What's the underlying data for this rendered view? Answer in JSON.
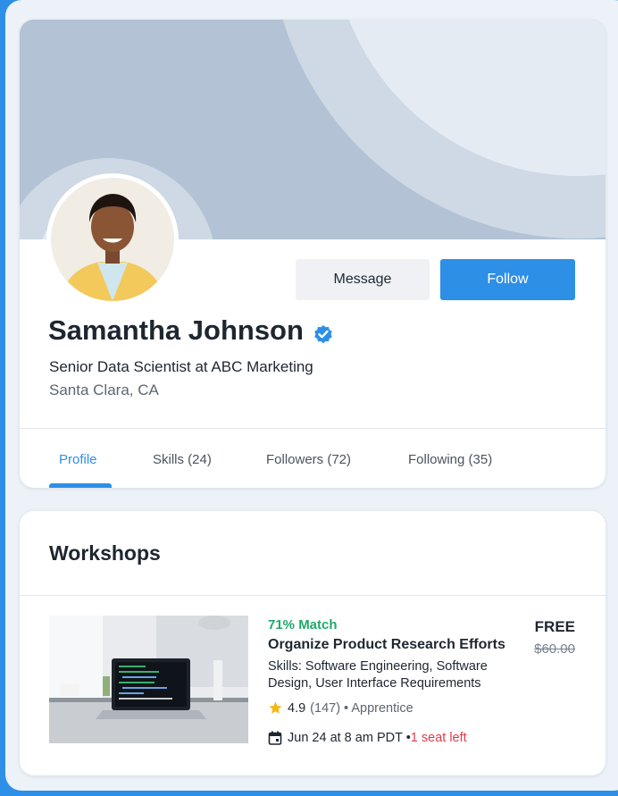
{
  "colors": {
    "accent": "#2d8fe6",
    "match_green": "#1faa6b",
    "alert_red": "#e23b4a",
    "text_dark": "#1e2631"
  },
  "profile": {
    "name": "Samantha Johnson",
    "verified_icon": "verified-badge-icon",
    "title": "Senior Data Scientist at ABC Marketing",
    "location": "Santa Clara, CA",
    "message_label": "Message",
    "follow_label": "Follow"
  },
  "tabs": [
    {
      "label": "Profile",
      "active": true
    },
    {
      "label": "Skills (24)",
      "active": false
    },
    {
      "label": "Followers (72)",
      "active": false
    },
    {
      "label": "Following (35)",
      "active": false
    }
  ],
  "workshops": {
    "heading": "Workshops",
    "items": [
      {
        "match": "71% Match",
        "title": "Organize Product Research Efforts",
        "skills": "Skills: Software Engineering, Software Design, User Interface Requirements",
        "rating": "4.9",
        "reviews": "(147)",
        "level": "• Apprentice",
        "date": "Jun 24 at 8 am PDT •",
        "seats": "1 seat left",
        "price": "FREE",
        "original_price": "$60.00",
        "icons": [
          "star-icon",
          "calendar-icon"
        ]
      }
    ]
  }
}
